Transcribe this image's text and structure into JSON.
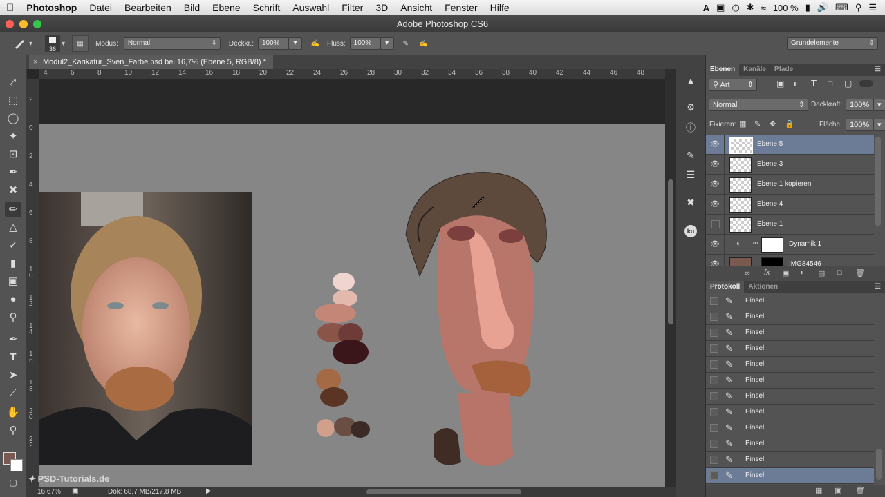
{
  "menubar": {
    "app": "Photoshop",
    "items": [
      "Datei",
      "Bearbeiten",
      "Bild",
      "Ebene",
      "Schrift",
      "Auswahl",
      "Filter",
      "3D",
      "Ansicht",
      "Fenster",
      "Hilfe"
    ],
    "battery": "100 %"
  },
  "window": {
    "title": "Adobe Photoshop CS6"
  },
  "options": {
    "brush_size": "36",
    "mode_label": "Modus:",
    "mode_value": "Normal",
    "opacity_label": "Deckkr.:",
    "opacity_value": "100%",
    "flow_label": "Fluss:",
    "flow_value": "100%",
    "workspace": "Grundelemente"
  },
  "document": {
    "tab_title": "Modul2_Karikatur_Sven_Farbe.psd bei 16,7% (Ebene 5, RGB/8) *",
    "ruler_h": [
      "4",
      "6",
      "8",
      "10",
      "12",
      "14",
      "16",
      "18",
      "20",
      "22",
      "24",
      "26",
      "28",
      "30",
      "32",
      "34",
      "36",
      "38",
      "40",
      "42",
      "44",
      "46",
      "48"
    ],
    "ruler_v": [
      "2",
      "0",
      "2",
      "4",
      "6",
      "8",
      "1\n0",
      "1\n2",
      "1\n4",
      "1\n6",
      "1\n8",
      "2\n0",
      "2\n2"
    ]
  },
  "status": {
    "zoom": "16,67%",
    "doc": "Dok: 68,7 MB/217,8 MB"
  },
  "watermark": "PSD-Tutorials.de",
  "layers_panel": {
    "tabs": [
      "Ebenen",
      "Kanäle",
      "Pfade"
    ],
    "filter": "Art",
    "blend_mode": "Normal",
    "opacity_label": "Deckkraft:",
    "opacity_value": "100%",
    "lock_label": "Fixieren:",
    "fill_label": "Fläche:",
    "fill_value": "100%",
    "layers": [
      {
        "name": "Ebene 5",
        "visible": true,
        "selected": true
      },
      {
        "name": "Ebene 3",
        "visible": true,
        "selected": false
      },
      {
        "name": "Ebene 1 kopieren",
        "visible": true,
        "selected": false
      },
      {
        "name": "Ebene 4",
        "visible": true,
        "selected": false
      },
      {
        "name": "Ebene 1",
        "visible": false,
        "selected": false
      },
      {
        "name": "Dynamik 1",
        "visible": true,
        "selected": false
      },
      {
        "name": "IMG84546",
        "visible": true,
        "selected": false
      }
    ]
  },
  "history_panel": {
    "tabs": [
      "Protokoll",
      "Aktionen"
    ],
    "items": [
      "Pinsel",
      "Pinsel",
      "Pinsel",
      "Pinsel",
      "Pinsel",
      "Pinsel",
      "Pinsel",
      "Pinsel",
      "Pinsel",
      "Pinsel",
      "Pinsel",
      "Pinsel"
    ]
  }
}
